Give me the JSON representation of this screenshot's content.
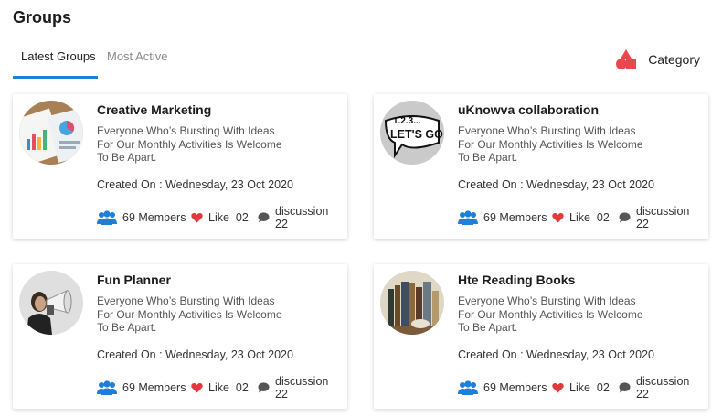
{
  "page": {
    "title": "Groups"
  },
  "tabs": [
    {
      "label": "Latest Groups",
      "active": true
    },
    {
      "label": "Most Active",
      "active": false
    }
  ],
  "category": {
    "label": "Category",
    "icon": "category-shapes-icon",
    "icon_color": "#e9484f"
  },
  "colors": {
    "accent": "#1e7fd6",
    "members_icon": "#1e7fd6",
    "like_icon": "#e03a3e",
    "discussion_icon": "#555555"
  },
  "groups": [
    {
      "title": "Creative Marketing",
      "avatar": "charts-and-documents-photo",
      "description": [
        "Everyone Who’s Bursting With Ideas",
        "For Our Monthly Activities Is Welcome",
        "To Be Apart."
      ],
      "created": "Created On : Wednesday, 23 Oct 2020",
      "members": "69 Members",
      "likes": "Like  02",
      "discussions": "discussion 22"
    },
    {
      "title": "uKnowva collaboration",
      "avatar": "lets-go-speech-bubble-photo",
      "avatar_text_top": "1.2.3...",
      "avatar_text_main": "LET'S GO!",
      "description": [
        "Everyone Who’s Bursting With Ideas",
        "For Our Monthly Activities Is Welcome",
        "To Be Apart."
      ],
      "created": "Created On : Wednesday, 23 Oct 2020",
      "members": "69 Members",
      "likes": "Like  02",
      "discussions": "discussion 22"
    },
    {
      "title": "Fun Planner",
      "avatar": "woman-with-megaphone-photo",
      "description": [
        "Everyone Who’s Bursting With Ideas",
        "For Our Monthly Activities Is Welcome",
        "To Be Apart."
      ],
      "created": "Created On : Wednesday, 23 Oct 2020",
      "members": "69 Members",
      "likes": "Like  02",
      "discussions": "discussion 22"
    },
    {
      "title": "Hte Reading Books",
      "avatar": "bookshelf-photo",
      "description": [
        "Everyone Who’s Bursting With Ideas",
        "For Our Monthly Activities Is Welcome",
        "To Be Apart."
      ],
      "created": "Created On : Wednesday, 23 Oct 2020",
      "members": "69 Members",
      "likes": "Like  02",
      "discussions": "discussion 22"
    }
  ]
}
